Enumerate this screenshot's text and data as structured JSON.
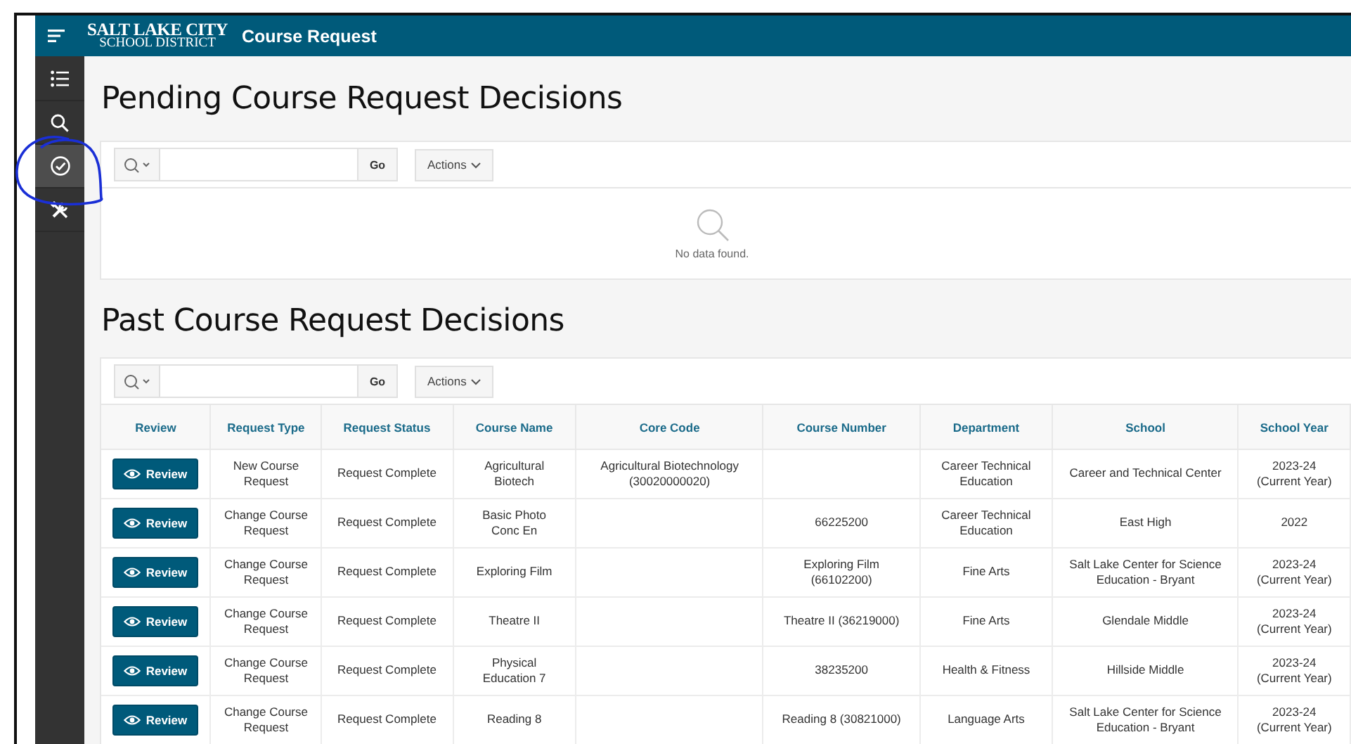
{
  "header": {
    "logo_line1": "SALT LAKE CITY",
    "logo_line2": "SCHOOL DISTRICT",
    "title": "Course Request"
  },
  "sidebar": {
    "items": [
      {
        "kind": "list",
        "selected": false
      },
      {
        "kind": "search",
        "selected": false
      },
      {
        "kind": "check",
        "selected": true
      },
      {
        "kind": "tools",
        "selected": false
      }
    ]
  },
  "pending": {
    "heading": "Pending Course Request Decisions",
    "go": "Go",
    "actions": "Actions",
    "empty": "No data found."
  },
  "past": {
    "heading": "Past Course Request Decisions",
    "go": "Go",
    "actions": "Actions",
    "columns": [
      "Review",
      "Request Type",
      "Request Status",
      "Course Name",
      "Core Code",
      "Course Number",
      "Department",
      "School",
      "School Year"
    ],
    "rows": [
      {
        "cells": [
          "Review",
          "New Course Request",
          "Request Complete",
          "Agricultural Biotech",
          "Agricultural Biotechnology (30020000020)",
          "",
          "Career Technical Education",
          "Career and Technical Center",
          "2023-24 (Current Year)"
        ]
      },
      {
        "cells": [
          "Review",
          "Change Course Request",
          "Request Complete",
          "Basic Photo Conc En",
          "",
          "66225200",
          "Career Technical Education",
          "East High",
          "2022"
        ]
      },
      {
        "cells": [
          "Review",
          "Change Course Request",
          "Request Complete",
          "Exploring Film",
          "",
          "Exploring Film (66102200)",
          "Fine Arts",
          "Salt Lake Center for Science Education - Bryant",
          "2023-24 (Current Year)"
        ]
      },
      {
        "cells": [
          "Review",
          "Change Course Request",
          "Request Complete",
          "Theatre II",
          "",
          "Theatre II (36219000)",
          "Fine Arts",
          "Glendale Middle",
          "2023-24 (Current Year)"
        ]
      },
      {
        "cells": [
          "Review",
          "Change Course Request",
          "Request Complete",
          "Physical Education 7",
          "",
          "38235200",
          "Health & Fitness",
          "Hillside Middle",
          "2023-24 (Current Year)"
        ]
      },
      {
        "cells": [
          "Review",
          "Change Course Request",
          "Request Complete",
          "Reading 8",
          "",
          "Reading 8 (30821000)",
          "Language Arts",
          "Salt Lake Center for Science Education - Bryant",
          "2023-24 (Current Year)"
        ]
      }
    ]
  }
}
